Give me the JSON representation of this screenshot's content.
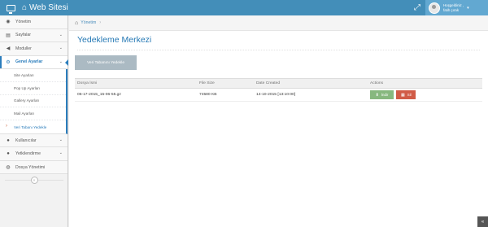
{
  "app": {
    "title": "Web Sitesi",
    "icon": "monitor-icon",
    "brand_icon": "home-icon"
  },
  "user": {
    "greeting": "Hoşgeldiniz ,",
    "name": "fatih çırak",
    "avatar_icon": "user-avatar",
    "caret": "▾"
  },
  "topbar": {
    "expand_icon": "⤢"
  },
  "sidebar": {
    "items": [
      {
        "label": "Yönetim",
        "icon": "dashboard-icon",
        "glyph": "◉"
      },
      {
        "label": "Sayfalar",
        "icon": "file-icon",
        "glyph": "▤",
        "arrow": "⌄"
      },
      {
        "label": "Moduller",
        "icon": "bullhorn-icon",
        "glyph": "◀",
        "arrow": "⌄"
      },
      {
        "label": "Genel Ayarlar",
        "icon": "cogs-icon",
        "glyph": "⚙",
        "arrow": "⌄"
      },
      {
        "label": "Kullanıcılar",
        "icon": "user-icon",
        "glyph": "●",
        "arrow": "⌄"
      },
      {
        "label": "Yetkilendirme",
        "icon": "users-icon",
        "glyph": "●",
        "arrow": "⌄"
      },
      {
        "label": "Dosya Yönetimi",
        "icon": "globe-icon",
        "glyph": "◍"
      }
    ],
    "submenu": [
      "Site Ayarları",
      "Pop Up Ayarları",
      "Gallery Ayarları",
      "Mail Ayarları",
      "Veri Tabanı Yedekle"
    ],
    "collapse_glyph": "«"
  },
  "breadcrumb": {
    "home_label": "Yönetim",
    "home_glyph": "⌂",
    "separator": "›"
  },
  "page": {
    "title": "Yedekleme Merkezi",
    "backup_button": "Veri Tabanını Yedekle"
  },
  "table": {
    "headers": [
      "Dosya İsmi",
      "File Size",
      "Date Created",
      "Actions"
    ],
    "rows": [
      {
        "file": "06-17-2015_15-06-55.gz",
        "size": "74580 KB",
        "date": "14-10-2015 [13:10:00]"
      }
    ],
    "download_label": "İndir",
    "download_glyph": "⬇",
    "delete_label": "Sil",
    "delete_glyph": "▦"
  },
  "scroll_top_glyph": "«",
  "colors": {
    "navbar": "#438eb9",
    "accent": "#2b7dbc",
    "success": "#87b87f",
    "danger": "#d15b47",
    "grey_button": "#abbac3"
  }
}
